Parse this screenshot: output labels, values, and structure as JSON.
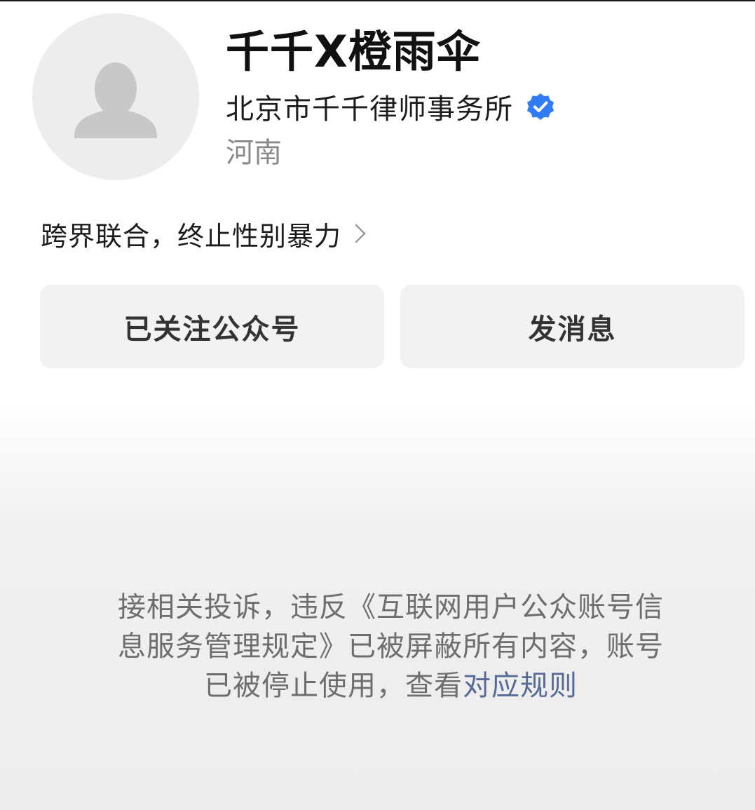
{
  "profile": {
    "name": "千千X橙雨伞",
    "organization": "北京市千千律师事务所",
    "verified_icon": "verified-badge-icon",
    "region": "河南",
    "slogan": "跨界联合，终止性别暴力"
  },
  "actions": {
    "follow_label": "已关注公众号",
    "message_label": "发消息"
  },
  "notice": {
    "line1": "接相关投诉，违反《互联网用户公众账号信",
    "line2": "息服务管理规定》已被屏蔽所有内容，账号",
    "line3_prefix": "已被停止使用，查看",
    "link_label": "对应规则"
  },
  "colors": {
    "verified_blue": "#2f7cf6",
    "link_blue": "#576b95",
    "button_bg": "#f2f2f2"
  }
}
